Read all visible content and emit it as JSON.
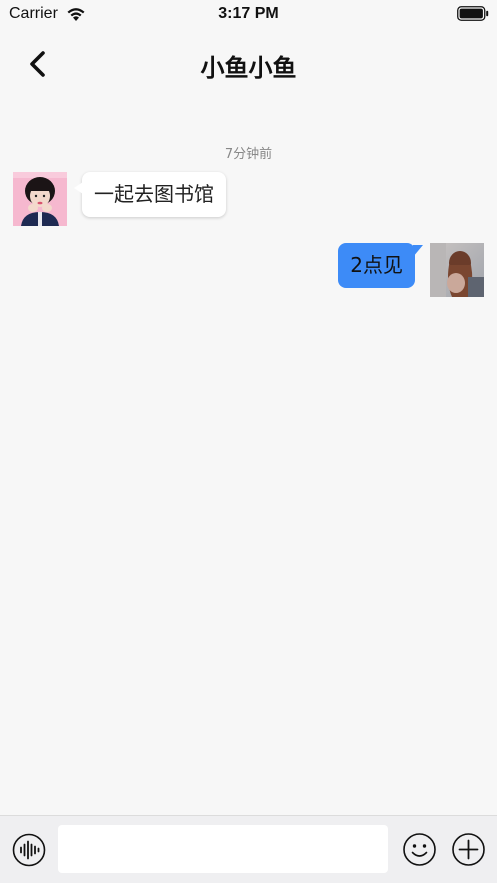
{
  "status_bar": {
    "carrier": "Carrier",
    "time": "3:17 PM",
    "icons": [
      "wifi-icon",
      "battery-icon"
    ]
  },
  "nav": {
    "title": "小鱼小鱼",
    "back_icon": "chevron-left-icon"
  },
  "conversation": {
    "timestamp": "7分钟前",
    "messages": [
      {
        "side": "left",
        "text": "一起去图书馆",
        "avatar": "friend-avatar"
      },
      {
        "side": "right",
        "text": "2点见",
        "avatar": "self-avatar"
      }
    ]
  },
  "input_bar": {
    "placeholder": "",
    "value": "",
    "icons": [
      "voice-icon",
      "emoji-icon",
      "plus-icon"
    ]
  },
  "colors": {
    "background": "#f7f7f7",
    "sent_bubble": "#3d8bf7",
    "received_bubble": "#ffffff",
    "input_bar": "#efeff1"
  }
}
